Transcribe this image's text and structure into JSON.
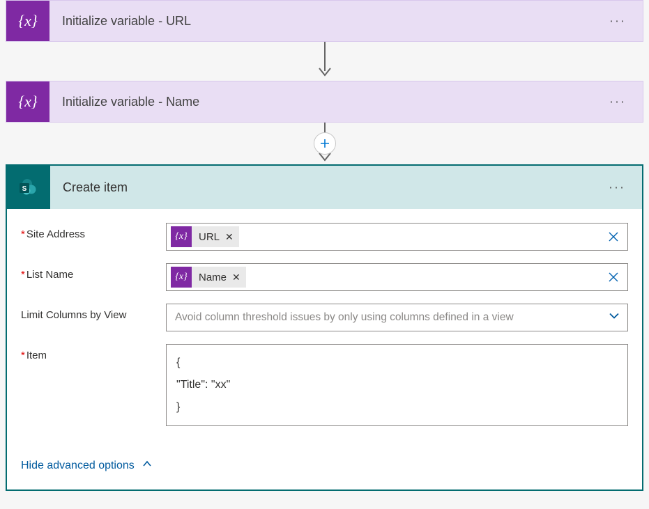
{
  "steps": {
    "var1": {
      "title": "Initialize variable - URL"
    },
    "var2": {
      "title": "Initialize variable - Name"
    },
    "create": {
      "title": "Create item"
    }
  },
  "fields": {
    "siteAddress": {
      "label": "Site Address",
      "tokenLabel": "URL"
    },
    "listName": {
      "label": "List Name",
      "tokenLabel": "Name"
    },
    "limitColumns": {
      "label": "Limit Columns by View",
      "placeholder": "Avoid column threshold issues by only using columns defined in a view"
    },
    "item": {
      "label": "Item",
      "line1": "{",
      "line2": "\"Title\": \"xx\"",
      "line3": "}"
    }
  },
  "advancedLinkLabel": "Hide advanced options",
  "icons": {
    "variableGlyph": "{x}",
    "tokenRemove": "✕"
  }
}
